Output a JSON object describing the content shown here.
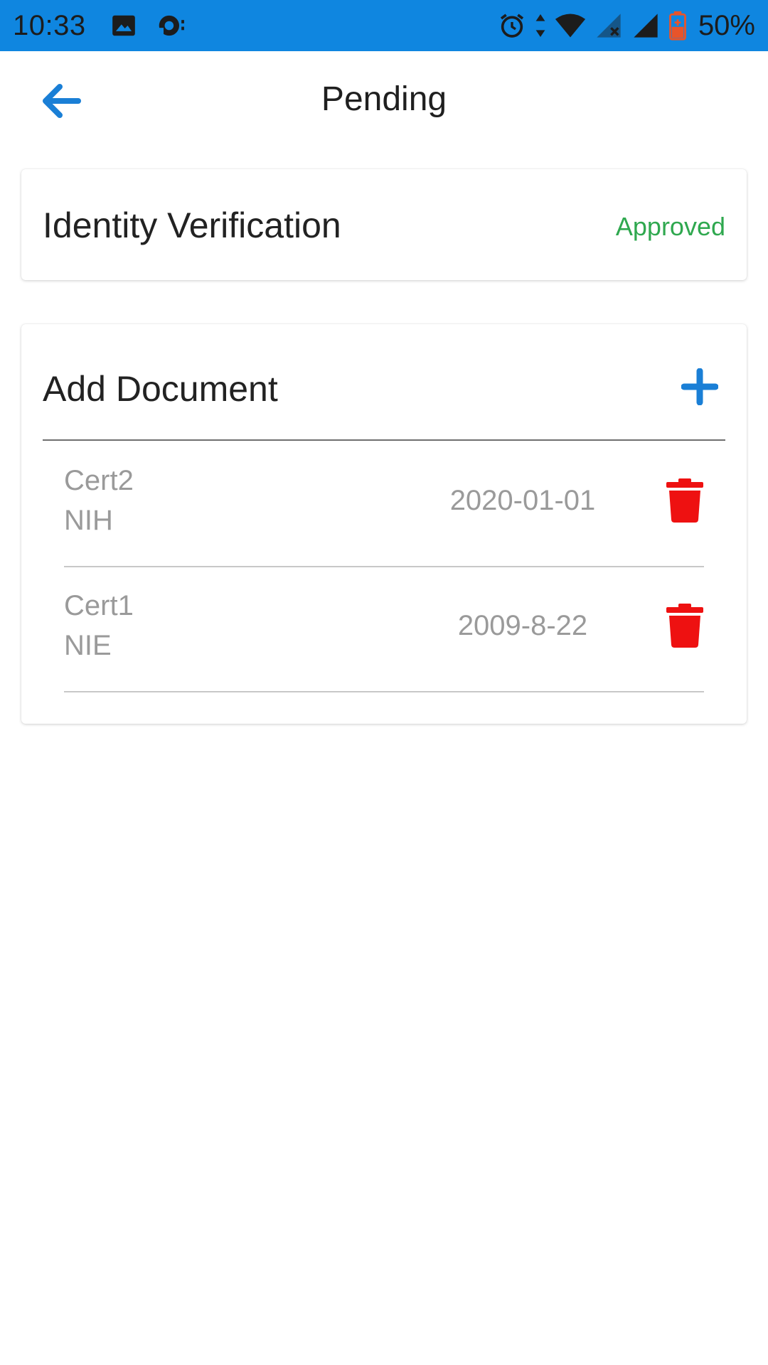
{
  "status_bar": {
    "time": "10:33",
    "battery": "50%",
    "background_color": "#0f86e0",
    "left_icons": [
      "image-icon",
      "sync-icon"
    ],
    "right_icons": [
      "alarm-icon",
      "data-arrows-icon",
      "wifi-icon",
      "signal-no-service-icon",
      "signal-icon",
      "battery-charging-icon"
    ]
  },
  "app_bar": {
    "title": "Pending",
    "back_icon": "arrow-left-icon",
    "accent_color": "#1a7fd6"
  },
  "identity_card": {
    "title": "Identity Verification",
    "status": "Approved",
    "status_color": "#2fa84f"
  },
  "documents_card": {
    "title": "Add Document",
    "add_icon": "plus-icon",
    "items": [
      {
        "name": "Cert2",
        "org": "NIH",
        "date": "2020-01-01",
        "delete_icon": "trash-icon"
      },
      {
        "name": "Cert1",
        "org": "NIE",
        "date": "2009-8-22",
        "delete_icon": "trash-icon"
      }
    ],
    "delete_color": "#ee1111"
  }
}
